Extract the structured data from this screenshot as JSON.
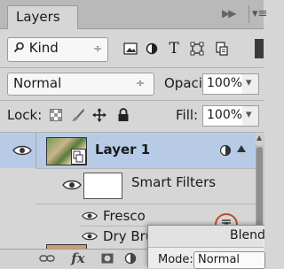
{
  "panel": {
    "tab_label": "Layers"
  },
  "icons": {
    "collapse": "collapse-arrows-icon",
    "panel_menu": "panel-menu-icon",
    "search": "search-icon",
    "eye": "eye-icon",
    "lock": "lock-icon",
    "move": "move-icon",
    "brush": "brush-icon",
    "checker": "transparency-checker-icon",
    "smart_object": "smart-object-icon",
    "blending_options": "blending-options-icon",
    "link": "link-icon",
    "fx": "fx-icon",
    "mask": "mask-icon",
    "adjustment": "adjustment-layer-icon"
  },
  "filter": {
    "kind_label": "Kind",
    "type_text_glyph": "T"
  },
  "blend": {
    "mode_value": "Normal",
    "opacity_label": "Opacity:",
    "opacity_value": "100%"
  },
  "lock": {
    "label": "Lock:",
    "fill_label": "Fill:",
    "fill_value": "100%"
  },
  "layers": [
    {
      "name": "Layer 1",
      "selected": true
    },
    {
      "name": "Smart Filters"
    },
    {
      "name": "Fresco"
    },
    {
      "name": "Dry Bru"
    }
  ],
  "footer": {
    "fx_label": "fx"
  },
  "dialog": {
    "title": "Blend",
    "mode_label": "Mode:",
    "mode_value": "Normal"
  },
  "colors": {
    "selected_row": "#b7cbe6",
    "highlight_ring": "#c34a1f",
    "panel_bg": "#d6d6d6"
  }
}
